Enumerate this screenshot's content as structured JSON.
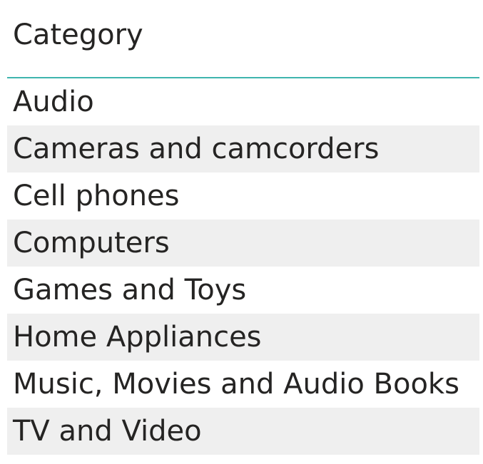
{
  "table": {
    "header": "Category",
    "rows": [
      "Audio",
      "Cameras and camcorders",
      "Cell phones",
      "Computers",
      "Games and Toys",
      "Home Appliances",
      "Music, Movies and Audio Books",
      "TV and Video"
    ]
  },
  "colors": {
    "header_underline": "#3fb5ae",
    "row_alt_background": "#efefef",
    "text": "#252423"
  }
}
